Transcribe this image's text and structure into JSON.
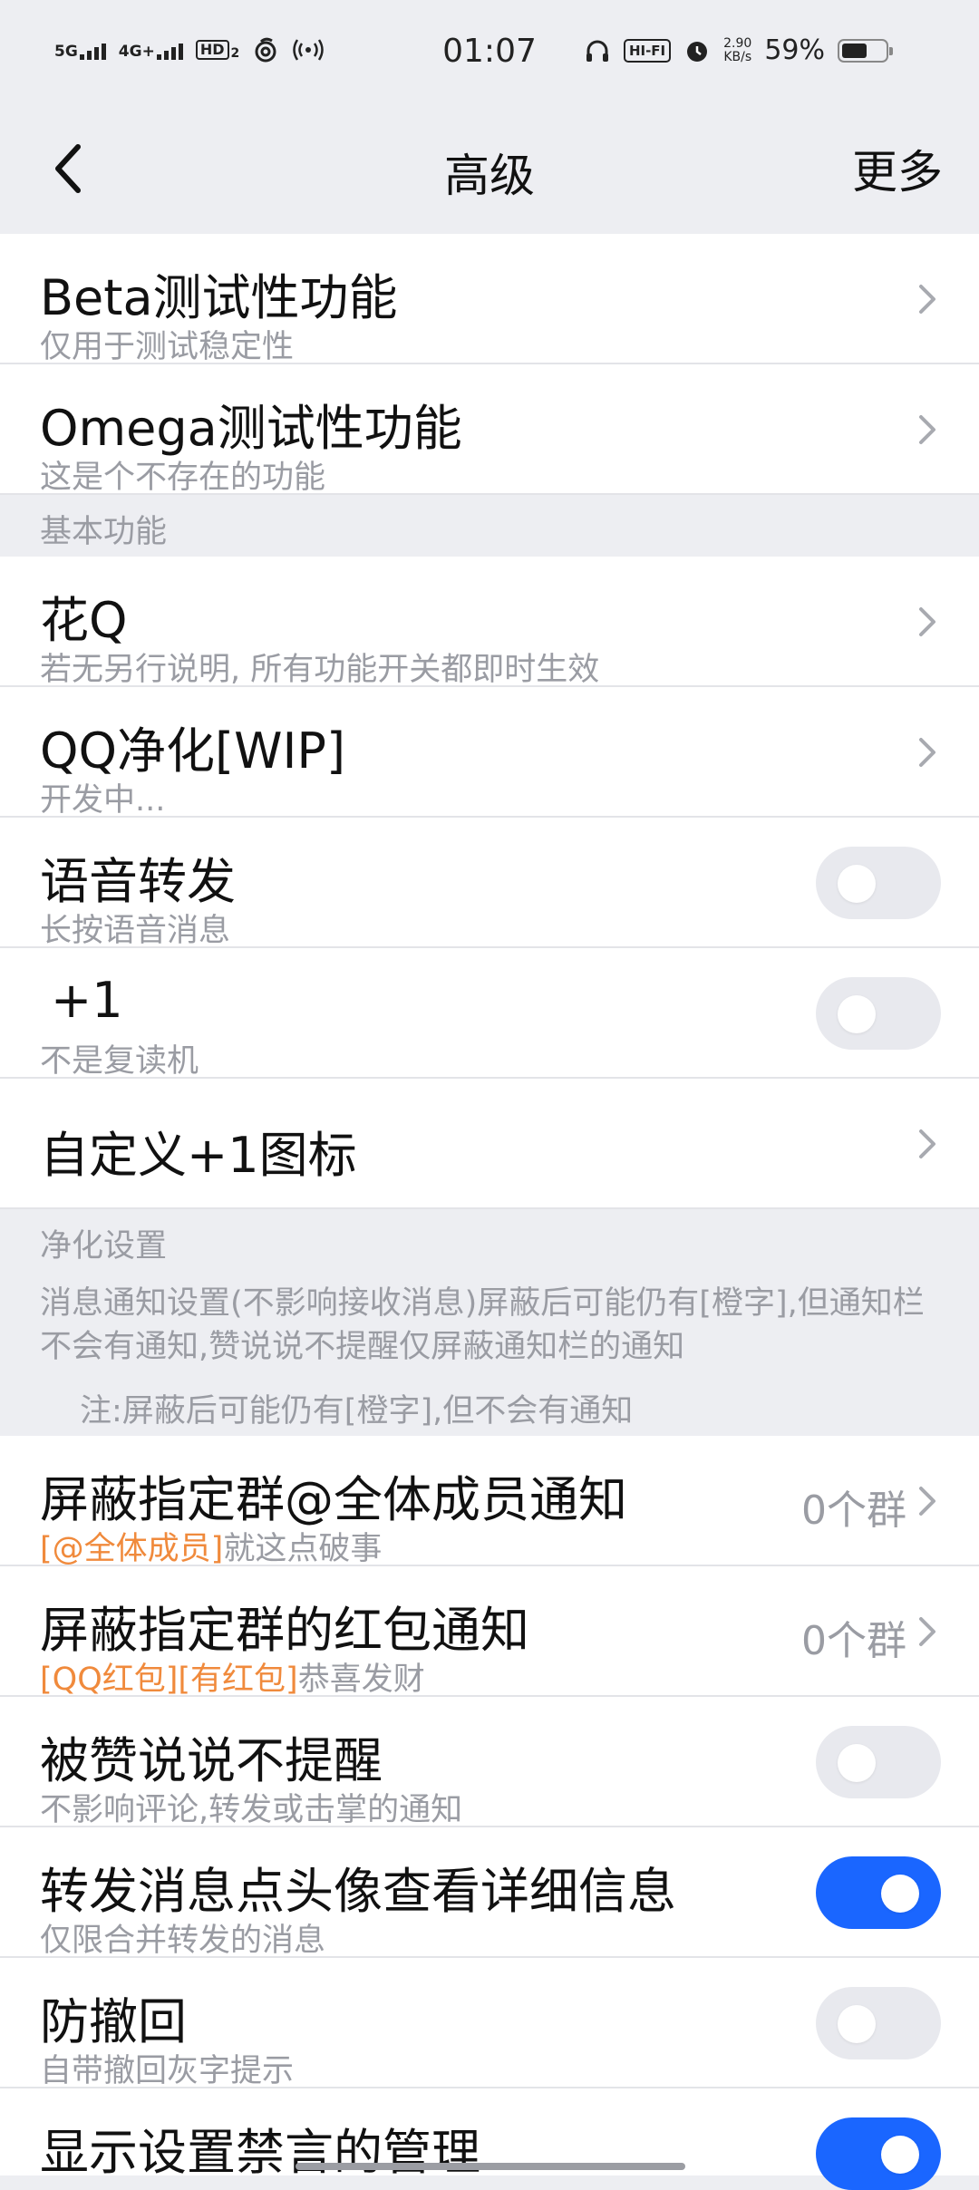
{
  "status": {
    "net1": "5G",
    "net2": "4G+",
    "hd": "HD",
    "hd_sub": "2",
    "time": "01:07",
    "hifi": "HI-FI",
    "speed_value": "2.90",
    "speed_unit": "KB/s",
    "battery": "59%",
    "battery_level": 0.59
  },
  "nav": {
    "title": "高级",
    "more": "更多"
  },
  "rows": {
    "beta": {
      "title": "Beta测试性功能",
      "sub": "仅用于测试稳定性"
    },
    "omega": {
      "title": "Omega测试性功能",
      "sub": "这是个不存在的功能"
    },
    "huaq": {
      "title": "花Q",
      "sub": "若无另行说明, 所有功能开关都即时生效"
    },
    "qqclean": {
      "title": "QQ净化[WIP]",
      "sub": "开发中..."
    },
    "voice": {
      "title": "语音转发",
      "sub": "长按语音消息",
      "on": false
    },
    "plusone": {
      "title": "+1",
      "sub": "不是复读机",
      "on": false
    },
    "custom_plusone": {
      "title": "自定义+1图标"
    },
    "at_all": {
      "title": "屏蔽指定群@全体成员通知",
      "sub_hl": "[@全体成员]",
      "sub": "就这点破事",
      "count": "0个群"
    },
    "redpacket": {
      "title": "屏蔽指定群的红包通知",
      "sub_hl": "[QQ红包][有红包]",
      "sub": "恭喜发财",
      "count": "0个群"
    },
    "liked": {
      "title": "被赞说说不提醒",
      "sub": "不影响评论,转发或击掌的通知",
      "on": false
    },
    "forward_avatar": {
      "title": "转发消息点头像查看详细信息",
      "sub": "仅限合并转发的消息",
      "on": true
    },
    "anti_recall": {
      "title": "防撤回",
      "sub": "自带撤回灰字提示",
      "on": false
    },
    "mute_admin": {
      "title": "显示设置禁言的管理",
      "on": true
    }
  },
  "sections": {
    "basic": "基本功能",
    "clean": {
      "head": "净化设置",
      "desc": "消息通知设置(不影响接收消息)屏蔽后可能仍有[橙字],但通知栏不会有通知,赞说说不提醒仅屏蔽通知栏的通知",
      "note": "注:屏蔽后可能仍有[橙字],但不会有通知"
    }
  },
  "colors": {
    "accent": "#1a66ff",
    "highlight": "#f08a3c",
    "background": "#edeef2"
  }
}
